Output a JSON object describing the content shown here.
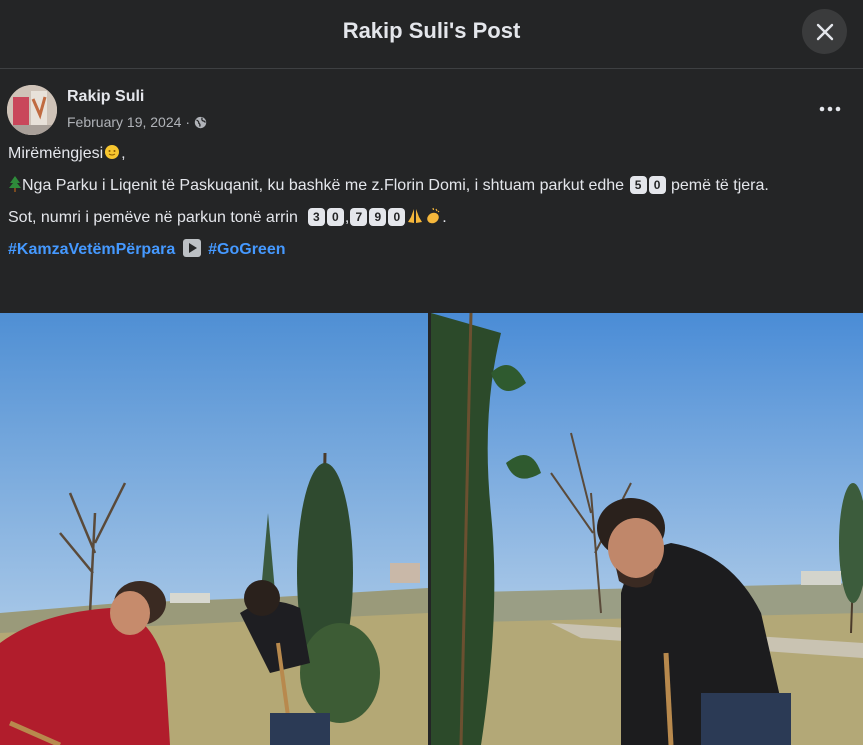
{
  "header": {
    "title": "Rakip Suli's Post"
  },
  "post": {
    "author": "Rakip Suli",
    "date": "February 19, 2024",
    "dot": "·",
    "greeting": "Mirëmëngjesi",
    "line1_a": "Nga Parku i Liqenit të Paskuqanit, ku bashkë me z.Florin Domi, i shtuam parkut edhe",
    "line1_digits": [
      "5",
      "0"
    ],
    "line1_b": "pemë të tjera.",
    "line2_a": "Sot, numri i pemëve në parkun tonë arrin",
    "line2_digits_a": [
      "3",
      "0"
    ],
    "line2_digits_b": [
      "7",
      "9",
      "0"
    ],
    "hashtags": [
      "#KamzaVetëmPërpara",
      "#GoGreen"
    ]
  },
  "icons": {
    "close": "close-icon",
    "more": "more-dots-icon",
    "globe": "globe-icon",
    "tree": "evergreen-tree-emoji",
    "sun": "sun-emoji",
    "pray": "pray-emoji",
    "clap": "clap-emoji",
    "play": "play-button-emoji"
  },
  "colors": {
    "background": "#242526",
    "text": "#e4e6eb",
    "secondary": "#b0b3b8",
    "link": "#4599ff"
  }
}
